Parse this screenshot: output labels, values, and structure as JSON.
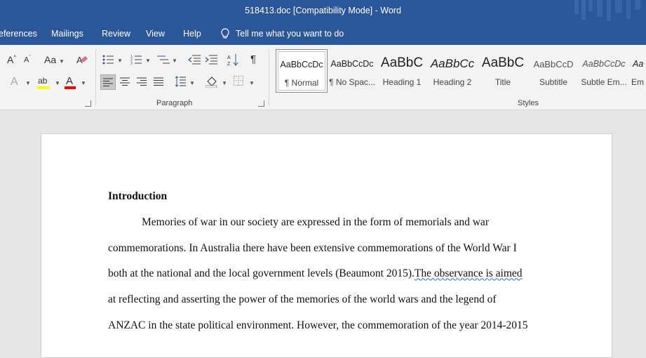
{
  "window": {
    "title": "518413.doc [Compatibility Mode]  -  Word"
  },
  "tabs": [
    "eferences",
    "Mailings",
    "Review",
    "View",
    "Help"
  ],
  "tell_me": {
    "label": "Tell me what you want to do",
    "icon": "lightbulb-icon"
  },
  "ribbon": {
    "paragraph_group_label": "Paragraph",
    "styles_group_label": "Styles",
    "styles": [
      {
        "preview": "AaBbCcDc",
        "name": "¶ Normal"
      },
      {
        "preview": "AaBbCcDc",
        "name": "¶ No Spac..."
      },
      {
        "preview": "AaBbC",
        "name": "Heading 1"
      },
      {
        "preview": "AaBbCc",
        "name": "Heading 2"
      },
      {
        "preview": "AaBbC",
        "name": "Title"
      },
      {
        "preview": "AaBbCcD",
        "name": "Subtitle"
      },
      {
        "preview": "AaBbCcDc",
        "name": "Subtle Em..."
      },
      {
        "preview": "Aa",
        "name": "Em"
      }
    ],
    "selected_style": "¶ Normal"
  },
  "document": {
    "heading": "Introduction",
    "lines": [
      "Memories of war in our society are expressed in the form of memorials and war",
      "commemorations. In Australia there have been extensive commemorations of the World War I",
      "both at the national and the local government levels (Beaumont 2015).",
      "at reflecting and asserting the power of the memories of the world wars and the legend of",
      "ANZAC in the state political environment. However, the commemoration of the year 2014-2015"
    ],
    "line3_continuation": "The observance is aimed"
  },
  "colors": {
    "title_bar": "#2b579a",
    "ribbon_bg": "#f3f3f3",
    "doc_bg": "#e6e6e6",
    "highlight_yellow": "#ffff00",
    "font_color_red": "#ff0000"
  }
}
